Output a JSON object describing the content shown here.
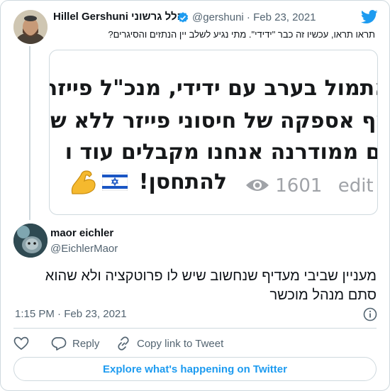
{
  "colors": {
    "brand": "#1d9bf0",
    "text": "#0f1419",
    "secondary": "#536471",
    "border": "#cfd9de"
  },
  "parent_tweet": {
    "author_name": "Hillel Gershuni הלל גרשוני",
    "handle_date": "@gershuni · Feb 23, 2021",
    "text": "תראו תראו, עכשיו זה כבר \"ידידי\". מתי נגיע לשלב יין הנתזים והסיגרים?",
    "media": {
      "lines": [
        "אתמול בערב עם ידידי, מנכ\"ל פייזר",
        "צף אספקה של חיסוני פייזר ללא ש",
        "גם ממודרנה אנחנו מקבלים עוד ו",
        "להתחסן!"
      ],
      "views": "1601",
      "edit_label": "edit"
    }
  },
  "reply_tweet": {
    "author_name": "maor eichler",
    "handle": "@EichlerMaor",
    "text": "מעניין שביבי מעדיף שנחשוב שיש לו פרוטקציה ולא שהוא סתם מנהל מוכשר",
    "timestamp": "1:15 PM · Feb 23, 2021"
  },
  "actions": {
    "reply": "Reply",
    "copy_link": "Copy link to Tweet"
  },
  "explore_label": "Explore what's happening on Twitter",
  "icons": [
    "twitter-bird-icon",
    "verified-badge-icon",
    "info-icon",
    "heart-icon",
    "reply-bubble-icon",
    "link-icon",
    "eye-icon",
    "flexed-biceps-emoji",
    "israel-flag-emoji"
  ]
}
